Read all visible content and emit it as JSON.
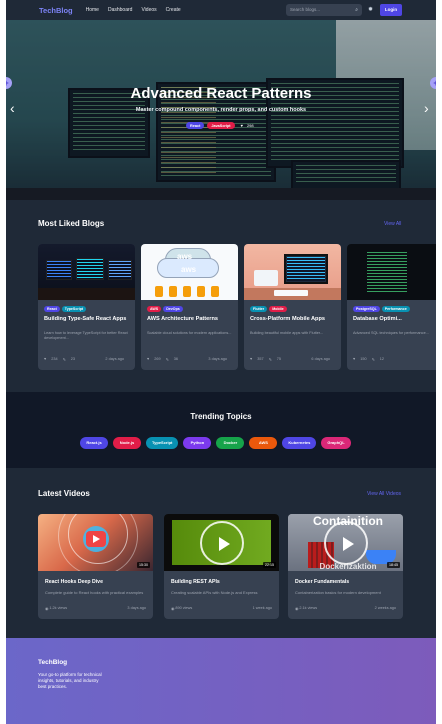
{
  "nav": {
    "logo": "TechBlog",
    "links": [
      "Home",
      "Dashboard",
      "Videos",
      "Create"
    ],
    "search_placeholder": "Search blogs...",
    "login_label": "Login"
  },
  "hero": {
    "title": "Advanced React Patterns",
    "subtitle": "Master compound components, render props, and custom hooks",
    "tags": [
      {
        "label": "React",
        "color": "#4f46e5"
      },
      {
        "label": "JavaScript",
        "color": "#e11d48"
      }
    ],
    "likes": "298"
  },
  "most_liked": {
    "title": "Most Liked Blogs",
    "view_all": "View All",
    "cards": [
      {
        "tags": [
          {
            "label": "React",
            "color": "#4f46e5"
          },
          {
            "label": "TypeScript",
            "color": "#0891b2"
          }
        ],
        "title": "Building Type-Safe React Apps",
        "desc": "Learn how to leverage TypeScript for better React development...",
        "likes": "234",
        "comments": "23",
        "date": "2 days ago"
      },
      {
        "tags": [
          {
            "label": "AWS",
            "color": "#e11d48"
          },
          {
            "label": "DevOps",
            "color": "#4f46e5"
          }
        ],
        "title": "AWS Architecture Patterns",
        "desc": "Scalable cloud solutions for modern applications...",
        "likes": "269",
        "comments": "36",
        "date": "3 days ago"
      },
      {
        "tags": [
          {
            "label": "Flutter",
            "color": "#0891b2"
          },
          {
            "label": "Mobile",
            "color": "#e11d48"
          }
        ],
        "title": "Cross-Platform Mobile Apps",
        "desc": "Building beautiful mobile apps with Flutter...",
        "likes": "357",
        "comments": "75",
        "date": "6 days ago"
      },
      {
        "tags": [
          {
            "label": "PostgreSQL",
            "color": "#4f46e5"
          },
          {
            "label": "Performance",
            "color": "#0891b2"
          }
        ],
        "title": "Database Optimi...",
        "desc": "Advanced SQL techniques for performance...",
        "likes": "150",
        "comments": "12",
        "date": ""
      }
    ]
  },
  "trending": {
    "title": "Trending Topics",
    "topics": [
      {
        "label": "React.js",
        "color": "#4f46e5"
      },
      {
        "label": "Node.js",
        "color": "#e11d48"
      },
      {
        "label": "TypeScript",
        "color": "#0891b2"
      },
      {
        "label": "Python",
        "color": "#7c3aed"
      },
      {
        "label": "Docker",
        "color": "#16a34a"
      },
      {
        "label": "AWS",
        "color": "#ea580c"
      },
      {
        "label": "Kubernetes",
        "color": "#4f46e5"
      },
      {
        "label": "GraphQL",
        "color": "#db2777"
      }
    ]
  },
  "videos": {
    "title": "Latest Videos",
    "view_all": "View All Videos",
    "cards": [
      {
        "title": "React Hooks Deep Dive",
        "desc": "Complete guide to React hooks with practical examples",
        "views": "1.2k views",
        "date": "3 days ago",
        "duration": "15:30"
      },
      {
        "title": "Building REST APIs",
        "desc": "Creating scalable APIs with Node.js and Express",
        "views": "890 views",
        "date": "1 week ago",
        "duration": "22:15"
      },
      {
        "title": "Docker Fundamentals",
        "desc": "Containerization basics for modern development",
        "views": "2.1k views",
        "date": "2 weeks ago",
        "duration": "18:45",
        "thumb_text": "Containition",
        "thumb_text2": "Dockerizaktion"
      }
    ]
  },
  "footer": {
    "brand": "TechBlog",
    "desc": "Your go-to platform for technical insights, tutorials, and industry best practices."
  }
}
